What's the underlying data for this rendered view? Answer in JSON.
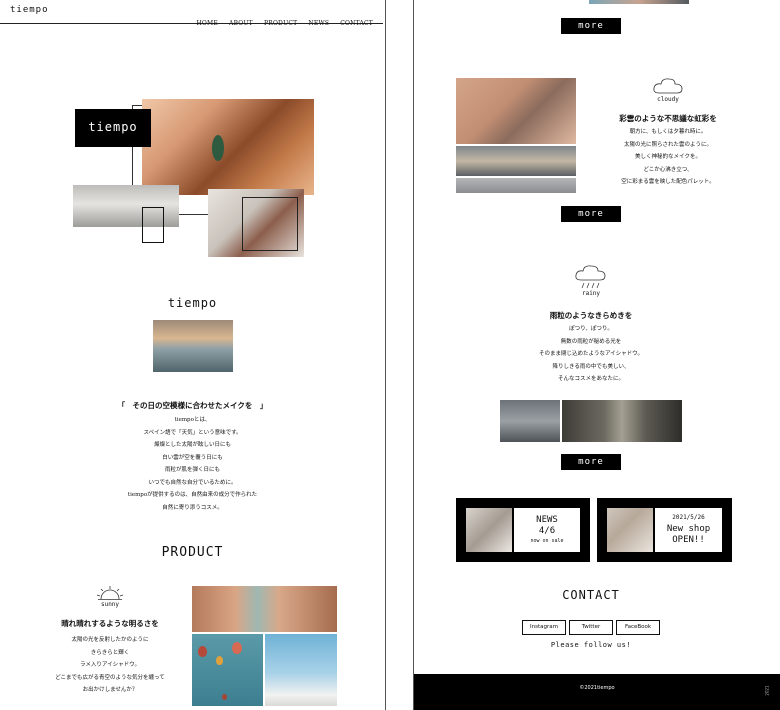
{
  "site": {
    "logo": "tiempo"
  },
  "nav": [
    {
      "label": "HOME"
    },
    {
      "label": "ABOUT"
    },
    {
      "label": "PRODUCT"
    },
    {
      "label": "NEWS"
    },
    {
      "label": "CONTACT"
    }
  ],
  "hero": {
    "logo_label": "tiempo"
  },
  "about": {
    "title": "tiempo",
    "heading": "「　その日の空模様に合わせたメイクを　」",
    "lines": [
      "tiempoとは、",
      "スペイン語で「天気」という意味です。",
      "燦燦とした太陽が眩しい日にも",
      "白い雲が空を覆う日にも",
      "雨粒が肌を弾く日にも",
      "いつでも自然な自分でいるために。",
      "tiempoが提供するのは、自然由来の成分で作られた",
      "自然に寄り添うコスメ。"
    ]
  },
  "product": {
    "title": "PRODUCT",
    "sunny": {
      "icon_label": "sunny",
      "heading": "晴れ晴れするような明るさを",
      "lines": [
        "太陽の光を反射したかのように",
        "きらきらと輝く",
        "ラメ入りアイシャドウ。",
        "どこまでも広がる青空のような気分を纏って",
        "お出かけしませんか？"
      ]
    },
    "cloudy": {
      "icon_label": "cloudy",
      "heading": "彩雲のような不思議な虹彩を",
      "lines": [
        "朝方に、もしくは夕暮れ時に。",
        "太陽の光に照らされた雲のように。",
        "美しく神秘的なメイクを。",
        "どこか心沸き立つ、",
        "空に彩まる雲を映した配色パレット。"
      ]
    },
    "rainy": {
      "icon_label": "rainy",
      "heading": "雨粒のようなきらめきを",
      "lines": [
        "ぽつり、ぽつり。",
        "無数の雨粒が秘める光を",
        "そのまま閉じ込めたようなアイシャドウ。",
        "降りしきる雨の中でも美しい、",
        "そんなコスメをあなたに。"
      ]
    },
    "more_label": "more"
  },
  "news": [
    {
      "title": "NEWS",
      "date": "4/6",
      "sub": "now on sale"
    },
    {
      "date": "2021/5/26",
      "title": "New shop",
      "sub": "OPEN!!"
    }
  ],
  "contact": {
    "title": "CONTACT",
    "buttons": [
      {
        "label": "Instagram"
      },
      {
        "label": "Twitter"
      },
      {
        "label": "FaceBook"
      }
    ],
    "follow": "Please follow us!"
  },
  "footer": {
    "copyright": "©2021tiempo",
    "side_note": "2021"
  }
}
